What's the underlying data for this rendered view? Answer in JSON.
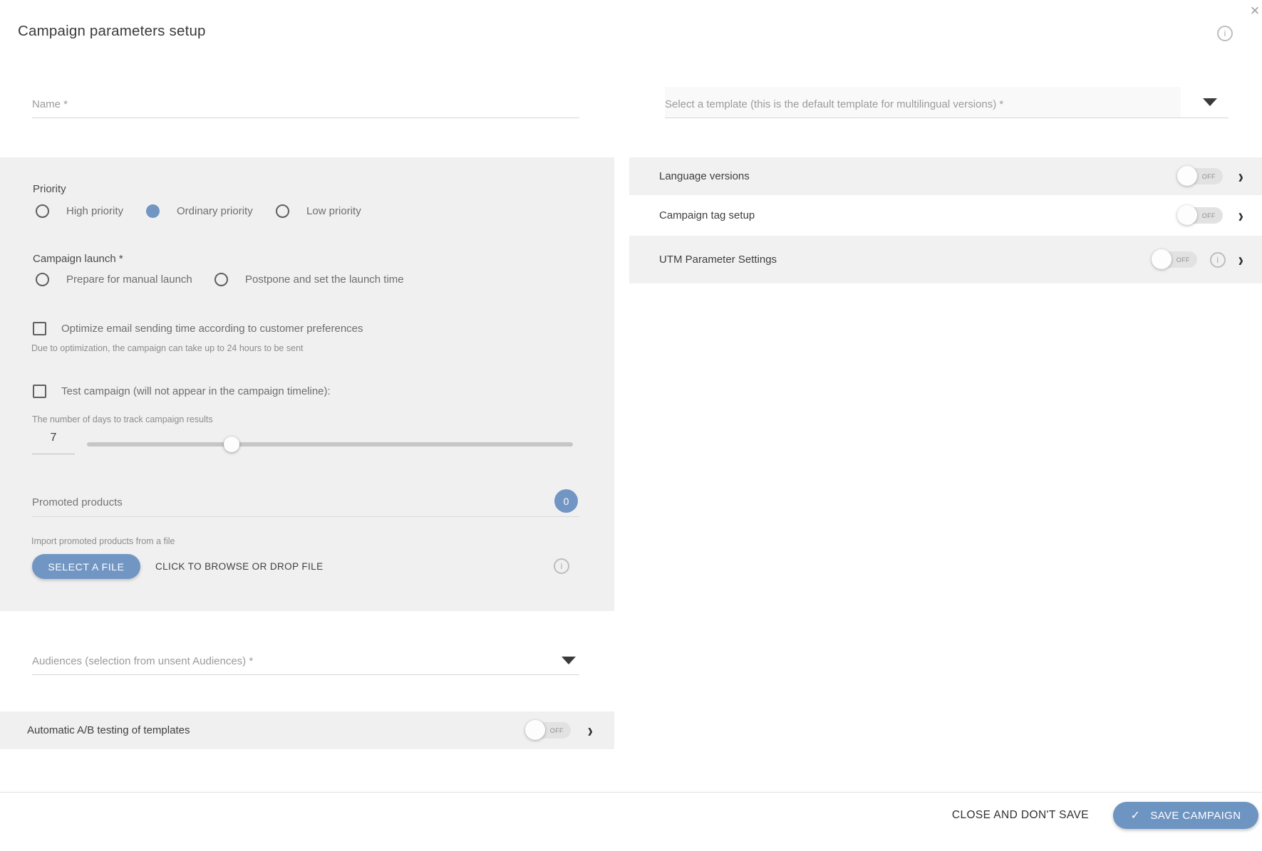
{
  "colors": {
    "accent": "#7196c4",
    "save_button": "#6e94c2",
    "panel_bg": "#f0f0f0"
  },
  "dialog": {
    "title": "Campaign parameters setup",
    "close_icon": "×",
    "info_icon": "i"
  },
  "fields": {
    "name": {
      "placeholder": "Name *"
    },
    "template": {
      "placeholder": "Select a template (this is the default template for multilingual versions) *"
    },
    "audiences": {
      "placeholder": "Audiences (selection from unsent Audiences) *"
    }
  },
  "priority": {
    "label": "Priority",
    "options": [
      {
        "label": "High priority",
        "selected": false
      },
      {
        "label": "Ordinary priority",
        "selected": true
      },
      {
        "label": "Low priority",
        "selected": false
      }
    ]
  },
  "campaign_launch": {
    "label": "Campaign launch *",
    "options": [
      {
        "label": "Prepare for manual launch",
        "selected": false
      },
      {
        "label": "Postpone and set the launch time",
        "selected": false
      }
    ]
  },
  "checkboxes": {
    "optimize": {
      "label": "Optimize email sending time according to customer preferences",
      "checked": false
    },
    "optimize_note": "Due to optimization, the campaign can take up to 24 hours to be sent",
    "test": {
      "label": "Test campaign (will not appear in the campaign timeline):",
      "checked": false
    }
  },
  "tracking_slider": {
    "label": "The number of days to track campaign results",
    "value": "7"
  },
  "promoted_products": {
    "label": "Promoted products",
    "count": "0",
    "import_label": "Import promoted products from a file",
    "select_file_button": "SELECT A FILE",
    "drop_hint": "CLICK TO BROWSE OR DROP FILE"
  },
  "ab_testing": {
    "label": "Automatic A/B testing of templates",
    "toggle_state": "OFF"
  },
  "side_panels": [
    {
      "label": "Language versions",
      "toggle_state": "OFF"
    },
    {
      "label": "Campaign tag setup",
      "toggle_state": "OFF"
    },
    {
      "label": "UTM Parameter Settings",
      "toggle_state": "OFF",
      "info_icon": "i"
    }
  ],
  "footer": {
    "close_label": "CLOSE AND DON'T SAVE",
    "save_label": "SAVE CAMPAIGN",
    "save_check": "✓"
  }
}
